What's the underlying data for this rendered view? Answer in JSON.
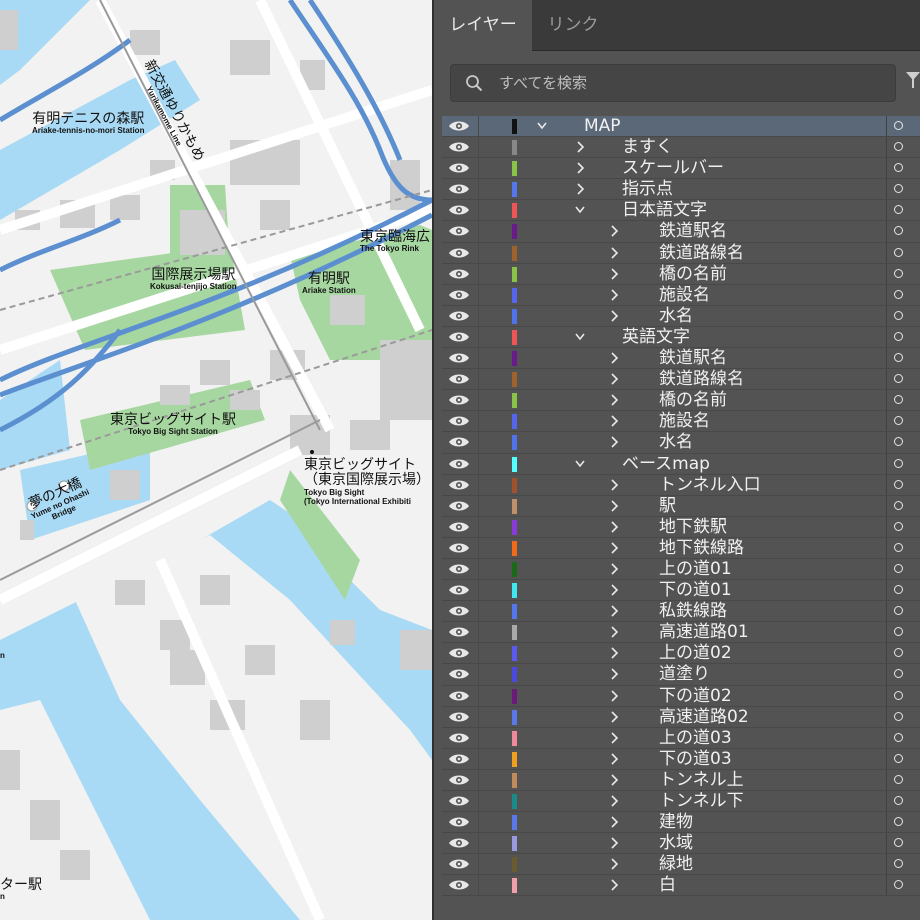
{
  "map": {
    "labels": [
      {
        "ja": "有明テニスの森駅",
        "en": "Ariake-tennis-no-mori Station"
      },
      {
        "ja": "国際展示場駅",
        "en": "Kokusai-tenjijo Station"
      },
      {
        "ja": "有明駅",
        "en": "Ariake Station"
      },
      {
        "ja": "東京臨海広",
        "en": "The Tokyo Rink"
      },
      {
        "ja": "東京ビッグサイト駅",
        "en": "Tokyo Big Sight Station"
      },
      {
        "ja": "東京ビッグサイト",
        "ja2": "（東京国際展示場）",
        "en": "Tokyo Big Sight",
        "en2": "(Tokyo International Exhibiti"
      },
      {
        "ja": "夢の大橋",
        "en": "Yume no Ohashi",
        "en2": "Bridge"
      },
      {
        "ja": "新交通ゆりかもめ",
        "en": "Yurikamome Line"
      },
      {
        "ja": "ター駅",
        "en": "n"
      },
      {
        "ja": "",
        "en": "n"
      }
    ],
    "colors": {
      "water": "#a8daf5",
      "green": "#a7d7a0",
      "building": "#cfcfcf",
      "land": "#f2f2f2",
      "road": "#5b8fd0"
    }
  },
  "panel": {
    "tabs": [
      {
        "label": "レイヤー",
        "active": true
      },
      {
        "label": "リンク",
        "active": false
      }
    ],
    "search": {
      "placeholder": "すべてを検索"
    },
    "layers": [
      {
        "name": "MAP",
        "level": 0,
        "color": "#111111",
        "expanded": true,
        "selected": true
      },
      {
        "name": "ますく",
        "level": 1,
        "color": "#888888",
        "expanded": false
      },
      {
        "name": "スケールバー",
        "level": 1,
        "color": "#8bc34a",
        "expanded": false
      },
      {
        "name": "指示点",
        "level": 1,
        "color": "#5577ee",
        "expanded": false
      },
      {
        "name": "日本語文字",
        "level": 1,
        "color": "#ee5555",
        "expanded": true
      },
      {
        "name": "鉄道駅名",
        "level": 2,
        "color": "#6a1b8a",
        "expanded": false
      },
      {
        "name": "鉄道路線名",
        "level": 2,
        "color": "#a0622d",
        "expanded": false
      },
      {
        "name": "橋の名前",
        "level": 2,
        "color": "#8bc34a",
        "expanded": false
      },
      {
        "name": "施設名",
        "level": 2,
        "color": "#5566ee",
        "expanded": false
      },
      {
        "name": "水名",
        "level": 2,
        "color": "#4f73ea",
        "expanded": false
      },
      {
        "name": "英語文字",
        "level": 1,
        "color": "#ee5555",
        "expanded": true
      },
      {
        "name": "鉄道駅名",
        "level": 2,
        "color": "#6a1b8a",
        "expanded": false
      },
      {
        "name": "鉄道路線名",
        "level": 2,
        "color": "#a0622d",
        "expanded": false
      },
      {
        "name": "橋の名前",
        "level": 2,
        "color": "#8bc34a",
        "expanded": false
      },
      {
        "name": "施設名",
        "level": 2,
        "color": "#5566ee",
        "expanded": false
      },
      {
        "name": "水名",
        "level": 2,
        "color": "#4f73ea",
        "expanded": false
      },
      {
        "name": "ベースmap",
        "level": 1,
        "color": "#55ffff",
        "expanded": true
      },
      {
        "name": "トンネル入口",
        "level": 2,
        "color": "#a0522d",
        "expanded": false
      },
      {
        "name": "駅",
        "level": 2,
        "color": "#c0906a",
        "expanded": false
      },
      {
        "name": "地下鉄駅",
        "level": 2,
        "color": "#8a3ad8",
        "expanded": false
      },
      {
        "name": "地下鉄線路",
        "level": 2,
        "color": "#f06a1a",
        "expanded": false
      },
      {
        "name": "上の道01",
        "level": 2,
        "color": "#1a6a1a",
        "expanded": false
      },
      {
        "name": "下の道01",
        "level": 2,
        "color": "#40e6f0",
        "expanded": false
      },
      {
        "name": "私鉄線路",
        "level": 2,
        "color": "#5577ee",
        "expanded": false
      },
      {
        "name": "高速道路01",
        "level": 2,
        "color": "#aaaaaa",
        "expanded": false
      },
      {
        "name": "上の道02",
        "level": 2,
        "color": "#5a5af0",
        "expanded": false
      },
      {
        "name": "道塗り",
        "level": 2,
        "color": "#4a4ae0",
        "expanded": false
      },
      {
        "name": "下の道02",
        "level": 2,
        "color": "#6a1b7a",
        "expanded": false
      },
      {
        "name": "高速道路02",
        "level": 2,
        "color": "#5a78e8",
        "expanded": false
      },
      {
        "name": "上の道03",
        "level": 2,
        "color": "#f08a9a",
        "expanded": false
      },
      {
        "name": "下の道03",
        "level": 2,
        "color": "#f0a020",
        "expanded": false
      },
      {
        "name": "トンネル上",
        "level": 2,
        "color": "#c08a5a",
        "expanded": false
      },
      {
        "name": "トンネル下",
        "level": 2,
        "color": "#1a8a8a",
        "expanded": false
      },
      {
        "name": "建物",
        "level": 2,
        "color": "#5a78e8",
        "expanded": false
      },
      {
        "name": "水域",
        "level": 2,
        "color": "#9a9ae0",
        "expanded": false
      },
      {
        "name": "緑地",
        "level": 2,
        "color": "#6a5a30",
        "expanded": false
      },
      {
        "name": "白",
        "level": 2,
        "color": "#f0a0a8",
        "expanded": false
      }
    ]
  }
}
